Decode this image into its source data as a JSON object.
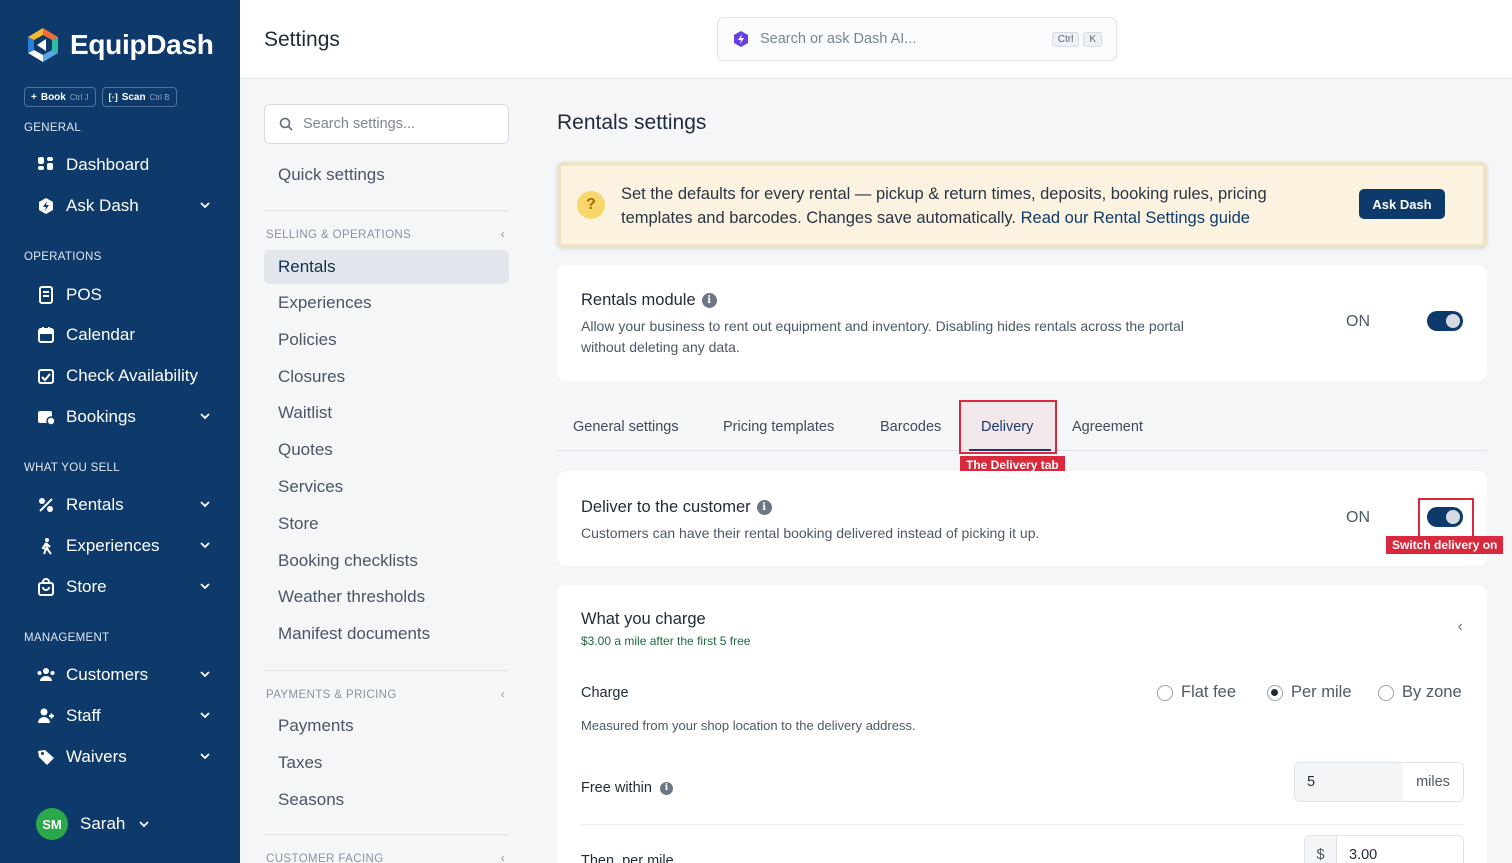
{
  "app": {
    "name": "EquipDash",
    "quick_actions": [
      {
        "label": "Book",
        "shortcut": "Ctrl J",
        "icon": "plus-icon"
      },
      {
        "label": "Scan",
        "shortcut": "Ctrl B",
        "icon": "scan-icon"
      }
    ]
  },
  "sidebar": {
    "sections": {
      "general": "GENERAL",
      "operations": "OPERATIONS",
      "what_you_sell": "WHAT YOU SELL",
      "management": "MANAGEMENT"
    },
    "items": [
      {
        "label": "Dashboard",
        "icon": "dashboard-icon",
        "has_chevron": false
      },
      {
        "label": "Ask Dash",
        "icon": "ask-dash-icon",
        "has_chevron": true
      },
      {
        "label": "POS",
        "icon": "pos-icon",
        "has_chevron": false
      },
      {
        "label": "Calendar",
        "icon": "calendar-icon",
        "has_chevron": false
      },
      {
        "label": "Check Availability",
        "icon": "check-availability-icon",
        "has_chevron": false
      },
      {
        "label": "Bookings",
        "icon": "bookings-icon",
        "has_chevron": true
      },
      {
        "label": "Rentals",
        "icon": "rentals-icon",
        "has_chevron": true
      },
      {
        "label": "Experiences",
        "icon": "experiences-icon",
        "has_chevron": true
      },
      {
        "label": "Store",
        "icon": "store-icon",
        "has_chevron": true
      },
      {
        "label": "Customers",
        "icon": "customers-icon",
        "has_chevron": true
      },
      {
        "label": "Staff",
        "icon": "staff-icon",
        "has_chevron": true
      },
      {
        "label": "Waivers",
        "icon": "waivers-icon",
        "has_chevron": true
      }
    ],
    "user": {
      "initials": "SM",
      "name": "Sarah",
      "avatar_color": "#2aa84a"
    }
  },
  "topbar": {
    "title": "Settings",
    "search_placeholder": "Search or ask Dash AI...",
    "search_keys": [
      "Ctrl",
      "K"
    ]
  },
  "settings_nav": {
    "search_placeholder": "Search settings...",
    "quick_settings": "Quick settings",
    "groups": [
      {
        "label": "SELLING & OPERATIONS",
        "items": [
          "Rentals",
          "Experiences",
          "Policies",
          "Closures",
          "Waitlist",
          "Quotes",
          "Services",
          "Store",
          "Booking checklists",
          "Weather thresholds",
          "Manifest documents"
        ]
      },
      {
        "label": "PAYMENTS & PRICING",
        "items": [
          "Payments",
          "Taxes",
          "Seasons"
        ]
      },
      {
        "label": "CUSTOMER FACING",
        "items": []
      }
    ],
    "active_item": "Rentals"
  },
  "main": {
    "title": "Rentals settings",
    "callout": {
      "text": "Set the defaults for every rental — pickup & return times, deposits, booking rules, pricing templates and barcodes. Changes save automatically.",
      "link": "Read our Rental Settings guide",
      "button": "Ask Dash"
    },
    "rentals_module": {
      "title": "Rentals module",
      "description": "Allow your business to rent out equipment and inventory. Disabling hides rentals across the portal without deleting any data.",
      "state": "ON"
    },
    "tabs": [
      "General settings",
      "Pricing templates",
      "Barcodes",
      "Delivery",
      "Agreement"
    ],
    "active_tab": "Delivery",
    "delivery": {
      "title": "Deliver to the customer",
      "description": "Customers can have their rental booking delivered instead of picking it up.",
      "state": "ON"
    },
    "charge_card": {
      "title": "What you charge",
      "summary": "$3.00 a mile after the first 5 free",
      "charge_label": "Charge",
      "charge_options": [
        "Flat fee",
        "Per mile",
        "By zone"
      ],
      "charge_selected": "Per mile",
      "charge_help": "Measured from your shop location to the delivery address.",
      "free_within_label": "Free within",
      "free_within_value": "5",
      "free_within_unit": "miles",
      "per_mile_label": "Then, per mile",
      "per_mile_currency": "$",
      "per_mile_value": "3.00"
    }
  },
  "annotations": {
    "delivery_tab": "The Delivery tab",
    "delivery_toggle": "Switch delivery on"
  },
  "colors": {
    "sidebar_bg": "#0e3a6b",
    "accent": "#0e3a6b",
    "annotation": "#d9293c",
    "callout_bg": "#fbf3e0"
  }
}
